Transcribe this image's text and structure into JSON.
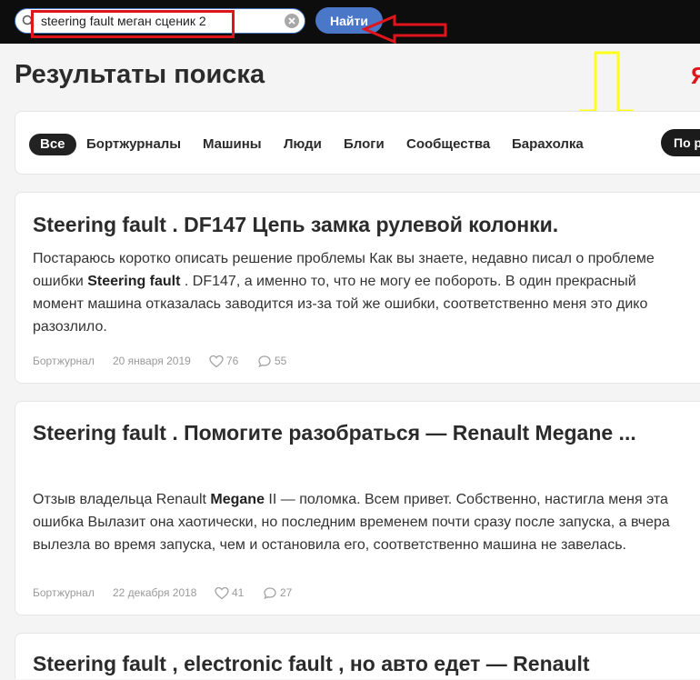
{
  "search": {
    "query": "steering fault меган сценик 2",
    "button_label": "Найти"
  },
  "page": {
    "title": "Результаты поиска",
    "side_mark": "Я"
  },
  "filters": {
    "tabs": [
      {
        "label": "Все",
        "active": true
      },
      {
        "label": "Бортжурналы",
        "active": false
      },
      {
        "label": "Машины",
        "active": false
      },
      {
        "label": "Люди",
        "active": false
      },
      {
        "label": "Блоги",
        "active": false
      },
      {
        "label": "Сообщества",
        "active": false
      },
      {
        "label": "Барахолка",
        "active": false
      }
    ],
    "sort_label": "По р"
  },
  "results": [
    {
      "title": "Steering fault . DF147 Цепь замка рулевой колонки.",
      "snippet": [
        {
          "text": "Постараюсь коротко описать решение проблемы Как вы знаете, недавно писал о проблеме ошибки ",
          "bold": false
        },
        {
          "text": "Steering fault",
          "bold": true
        },
        {
          "text": " . DF147, а именно то, что не могу ее побороть. В один прекрасный момент машина отказалась заводится из-за той же ошибки, соответственно меня это дико разозлило.",
          "bold": false
        }
      ],
      "source": "Бортжурнал",
      "date": "20 января 2019",
      "likes": "76",
      "comments": "55"
    },
    {
      "title": "Steering fault . Помогите разобраться — Renault Megane ...",
      "snippet": [
        {
          "text": "Отзыв владельца Renault ",
          "bold": false
        },
        {
          "text": "Megane",
          "bold": true
        },
        {
          "text": " II — поломка. Всем привет. Собственно, настигла меня эта ошибка Вылазит она хаотически, но последним временем почти сразу после запуска, а вчера вылезла во время запуска, чем и остановила его, соответственно машина не завелась.",
          "bold": false
        }
      ],
      "source": "Бортжурнал",
      "date": "22 декабря 2018",
      "likes": "41",
      "comments": "27"
    },
    {
      "title": "Steering fault , electronic fault , но авто едет — Renault"
    }
  ],
  "colors": {
    "topbar": "#0d0d0d",
    "button": "#4b77c8",
    "annotation_red": "#e0141b",
    "annotation_yellow": "#ffff1a"
  }
}
